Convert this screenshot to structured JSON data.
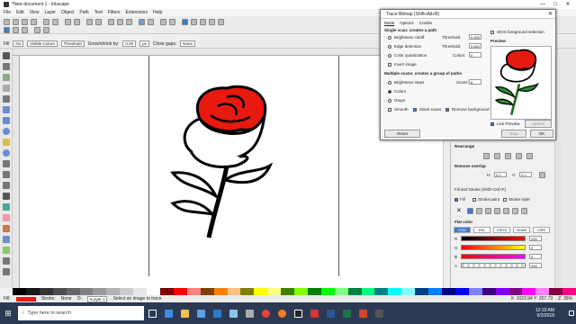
{
  "window": {
    "title": "*New document 1 - Inkscape",
    "controls": [
      "—",
      "□",
      "✕"
    ]
  },
  "menu": [
    "File",
    "Edit",
    "View",
    "Layer",
    "Object",
    "Path",
    "Text",
    "Filters",
    "Extensions",
    "Help"
  ],
  "control_bar": {
    "fill_label": "Fill",
    "fill_value": "No",
    "visible_colors": "Visible Colors",
    "threshold": "Threshold",
    "grow_label": "Grow/shrink by:",
    "grow_value": "0.00",
    "unit": "px",
    "close_gaps_label": "Close gaps:",
    "close_gaps_value": "None"
  },
  "trace_dialog": {
    "title": "Trace Bitmap (Shift+Alt+B)",
    "tabs": [
      "Mode",
      "Options",
      "Credits"
    ],
    "single_scan_header": "Single scan: creates a path",
    "brightness_cutoff": "Brightness cutoff",
    "edge_detection": "Edge detection",
    "color_quantization": "Color quantization",
    "invert_image": "Invert image",
    "threshold_label": "Threshold:",
    "threshold_1": "0.450",
    "threshold_2": "0.650",
    "colors_label": "Colors:",
    "colors_value": "8",
    "multi_scan_header": "Multiple scans: creates a group of paths",
    "brightness_steps": "Brightness steps",
    "scans_label": "Scans:",
    "scans_value": "8",
    "colors_option": "Colors",
    "grays_option": "Grays",
    "smooth": "Smooth",
    "stack_scans": "Stack scans",
    "remove_background": "Remove background",
    "sioxx": "SIOX foreground selection",
    "preview_label": "Preview",
    "live_preview": "Live Preview",
    "update": "Update",
    "reset": "Reset",
    "stop": "Stop",
    "ok": "OK"
  },
  "dock": {
    "rearrange": "Rearrange",
    "remove_overlap": "Remove overlap",
    "h_label": "H:",
    "h_value": "0.0",
    "v_label": "V:",
    "v_value": "0.0",
    "fill_stroke_title": "Fill and Stroke (Shift+Ctrl+F)",
    "tab_fill": "Fill",
    "tab_stroke_paint": "Stroke paint",
    "tab_stroke_style": "Stroke style",
    "flat_color": "Flat color",
    "color_tabs": [
      "RGB",
      "HSL",
      "CMYK",
      "Wheel",
      "CMS"
    ],
    "channels": [
      "R",
      "G",
      "B",
      "A"
    ],
    "values": [
      "255",
      "0",
      "0",
      "255"
    ]
  },
  "status": {
    "fill": "Fill:",
    "stroke": "Stroke:",
    "stroke_value": "None",
    "opacity": "O:",
    "layer": "•Layer 1",
    "message": "Select an image to trace",
    "coords": "X: 1023.94  Y: 207.73",
    "zoom": "Z: 35%"
  },
  "taskbar": {
    "search_placeholder": "Type here to search",
    "time": "12:10 AM",
    "date": "9/2/2018"
  },
  "colors": {
    "accent": "#3a7bd5",
    "rose": "#e8190f",
    "taskbar": "#2b3a52"
  }
}
